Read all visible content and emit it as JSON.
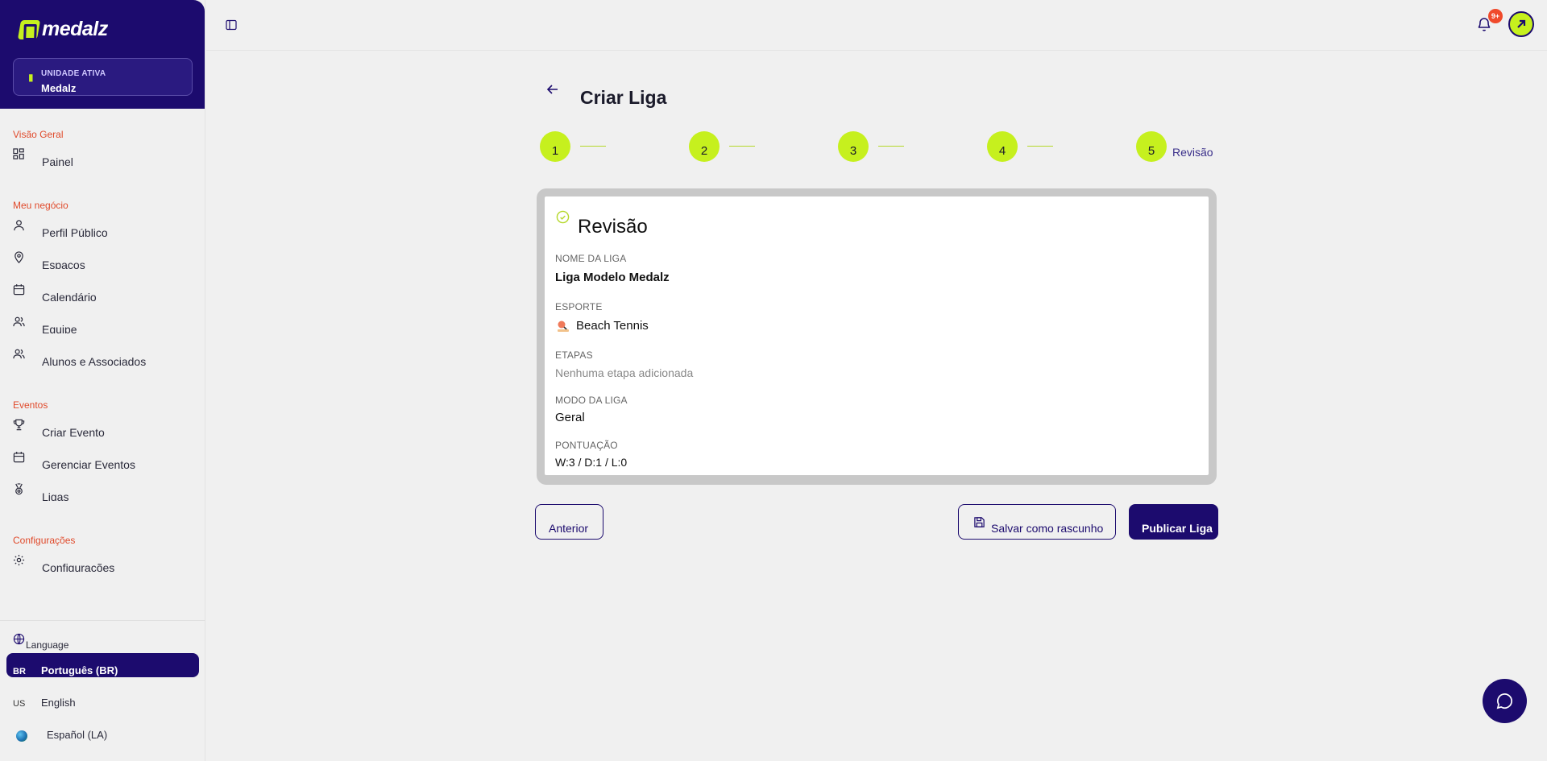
{
  "brand": {
    "name": "medalz",
    "accent": "#c6f01e",
    "primary": "#1c0b6e"
  },
  "unit": {
    "label": "UNIDADE ATIVA",
    "name": "Medalz"
  },
  "nav": {
    "sections": [
      {
        "title": "Visão Geral",
        "items": [
          {
            "label": "Painel",
            "icon": "grid-icon"
          }
        ]
      },
      {
        "title": "Meu negócio",
        "items": [
          {
            "label": "Perfil Público",
            "icon": "user-icon"
          },
          {
            "label": "Espaços",
            "icon": "map-pin-icon"
          },
          {
            "label": "Calendário",
            "icon": "calendar-icon"
          },
          {
            "label": "Equipe",
            "icon": "users-icon"
          },
          {
            "label": "Alunos e Associados",
            "icon": "users-icon"
          }
        ]
      },
      {
        "title": "Eventos",
        "items": [
          {
            "label": "Criar Evento",
            "icon": "trophy-icon"
          },
          {
            "label": "Gerenciar Eventos",
            "icon": "calendar-icon"
          },
          {
            "label": "Ligas",
            "icon": "medal-icon"
          }
        ]
      },
      {
        "title": "Configurações",
        "items": [
          {
            "label": "Configurações",
            "icon": "gear-icon"
          }
        ]
      }
    ]
  },
  "language": {
    "title": "Language",
    "options": [
      {
        "code": "BR",
        "name": "Português (BR)",
        "active": true
      },
      {
        "code": "US",
        "name": "English",
        "active": false
      },
      {
        "code": "",
        "name": "Español (LA)",
        "active": false
      }
    ]
  },
  "header": {
    "notifications_badge": "9+"
  },
  "page": {
    "title": "Criar Liga",
    "steps": [
      "1",
      "2",
      "3",
      "4",
      "5"
    ],
    "current_step_label": "Revisão"
  },
  "review": {
    "title": "Revisão",
    "fields": {
      "league_name_label": "NOME DA LIGA",
      "league_name": "Liga Modelo Medalz",
      "sport_label": "ESPORTE",
      "sport": "Beach Tennis",
      "stages_label": "ETAPAS",
      "stages": "Nenhuma etapa adicionada",
      "mode_label": "MODO DA LIGA",
      "mode": "Geral",
      "scoring_label": "PONTUAÇÃO",
      "scoring": "W:3 / D:1 / L:0"
    }
  },
  "actions": {
    "previous": "Anterior",
    "save_draft": "Salvar como rascunho",
    "publish": "Publicar Liga"
  }
}
